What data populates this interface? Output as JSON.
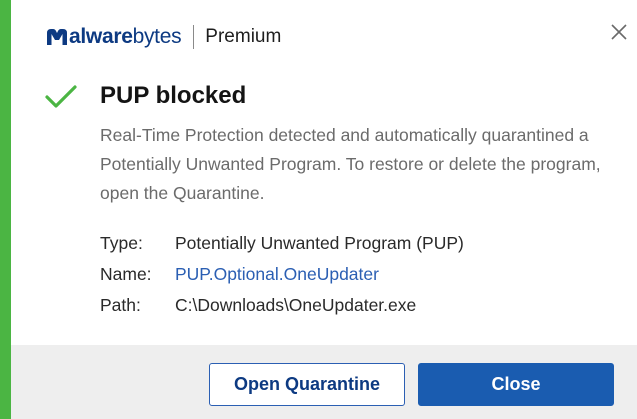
{
  "brand": {
    "logo_text_bold": "alware",
    "logo_text_light": "bytes",
    "product": "Premium",
    "logo_color": "#0d3a82"
  },
  "window": {
    "close_icon": "close-icon"
  },
  "notification": {
    "status_icon": "checkmark-icon",
    "title": "PUP blocked",
    "description": "Real-Time Protection detected and automatically quarantined a Potentially Unwanted Program. To restore or delete the program, open the Quarantine.",
    "details": {
      "type_label": "Type:",
      "type_value": "Potentially Unwanted Program (PUP)",
      "name_label": "Name:",
      "name_value": "PUP.Optional.OneUpdater",
      "path_label": "Path:",
      "path_value": "C:\\Downloads\\OneUpdater.exe"
    }
  },
  "actions": {
    "open_quarantine_label": "Open Quarantine",
    "close_label": "Close"
  },
  "colors": {
    "accent_green": "#4bb543",
    "primary_blue": "#1a5cb0",
    "link_blue": "#2b5fb3"
  }
}
